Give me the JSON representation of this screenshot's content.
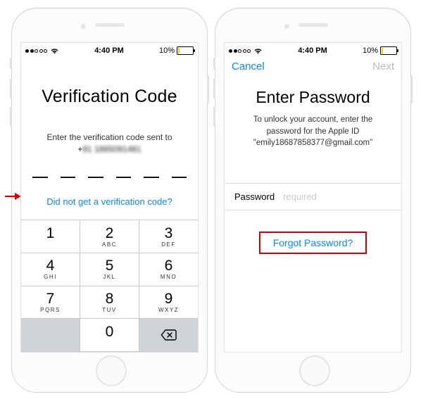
{
  "status": {
    "carrier_dots": 5,
    "carrier_filled": 2,
    "time": "4:40 PM",
    "battery_pct": "10%"
  },
  "left": {
    "title": "Verification Code",
    "subtitle": "Enter the verification code sent to",
    "phone_prefix": "+",
    "phone_hidden": "91 1865091481",
    "did_not_get": "Did not get a verification code?",
    "code_length": 6,
    "keys": [
      {
        "n": "1",
        "l": ""
      },
      {
        "n": "2",
        "l": "ABC"
      },
      {
        "n": "3",
        "l": "DEF"
      },
      {
        "n": "4",
        "l": "GHI"
      },
      {
        "n": "5",
        "l": "JKL"
      },
      {
        "n": "6",
        "l": "MNO"
      },
      {
        "n": "7",
        "l": "PQRS"
      },
      {
        "n": "8",
        "l": "TUV"
      },
      {
        "n": "9",
        "l": "WXYZ"
      },
      {
        "n": "0",
        "l": ""
      }
    ]
  },
  "right": {
    "cancel": "Cancel",
    "next": "Next",
    "title": "Enter Password",
    "sub1": "To unlock your account, enter the",
    "sub2": "password for the Apple ID",
    "email": "\"emily18687858377@gmail.com\"",
    "pw_label": "Password",
    "pw_placeholder": "required",
    "forgot": "Forgot Password?"
  }
}
